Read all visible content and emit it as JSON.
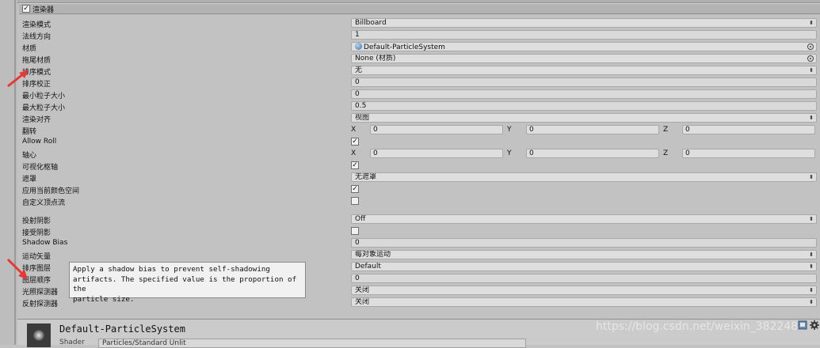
{
  "header": {
    "title": "渲染器",
    "enabled": true
  },
  "properties": [
    {
      "label": "渲染模式",
      "type": "dropdown",
      "value": "Billboard"
    },
    {
      "label": "法线方向",
      "type": "text",
      "value": "1"
    },
    {
      "label": "材质",
      "type": "object",
      "value": "Default-ParticleSystem",
      "icon": "material-sphere-icon"
    },
    {
      "label": "拖尾材质",
      "type": "object",
      "value": "None (材质)"
    },
    {
      "label": "排序模式",
      "type": "dropdown",
      "value": "无"
    },
    {
      "label": "排序校正",
      "type": "text",
      "value": "0"
    },
    {
      "label": "最小粒子大小",
      "type": "text",
      "value": "0"
    },
    {
      "label": "最大粒子大小",
      "type": "text",
      "value": "0.5"
    },
    {
      "label": "渲染对齐",
      "type": "dropdown",
      "value": "视图"
    },
    {
      "label": "翻转",
      "type": "xyz",
      "x": "0",
      "y": "0",
      "z": "0"
    },
    {
      "label": "Allow Roll",
      "type": "checkbox",
      "checked": true
    },
    {
      "label": "轴心",
      "type": "xyz",
      "x": "0",
      "y": "0",
      "z": "0"
    },
    {
      "label": "可视化枢轴",
      "type": "checkbox",
      "checked": true
    },
    {
      "label": "遮罩",
      "type": "dropdown",
      "value": "无遮罩"
    },
    {
      "label": "应用当前颜色空间",
      "type": "checkbox",
      "checked": true
    },
    {
      "label": "自定义顶点流",
      "type": "checkbox",
      "checked": false
    },
    {
      "label": "投射阴影",
      "type": "dropdown",
      "value": "Off"
    },
    {
      "label": "接受阴影",
      "type": "checkbox",
      "checked": false
    },
    {
      "label": "Shadow Bias",
      "type": "text",
      "value": "0"
    },
    {
      "label": "运动矢量",
      "type": "dropdown",
      "value": "每对象运动"
    },
    {
      "label": "排序图层",
      "type": "dropdown",
      "value": "Default"
    },
    {
      "label": "图层顺序",
      "type": "text",
      "value": "0"
    },
    {
      "label": "光照探测器",
      "type": "dropdown",
      "value": "关闭"
    },
    {
      "label": "反射探测器",
      "type": "dropdown",
      "value": "关闭"
    }
  ],
  "axis_labels": {
    "x": "X",
    "y": "Y",
    "z": "Z"
  },
  "tooltip": {
    "line1": "Apply a shadow bias to prevent self-shadowing",
    "line2": "artifacts. The specified value is the proportion of the",
    "line3": "particle size."
  },
  "material_footer": {
    "name": "Default-ParticleSystem",
    "shader_label": "Shader",
    "shader_value": "Particles/Standard Unlit"
  },
  "watermark": "https://blog.csdn.net/weixin_3822480",
  "colors": {
    "annotation_arrow": "#e53935"
  }
}
